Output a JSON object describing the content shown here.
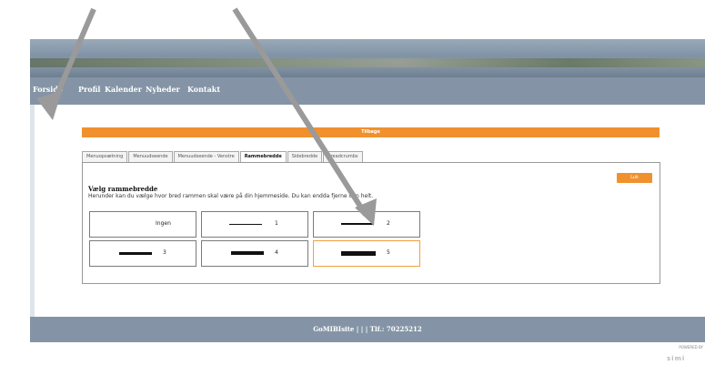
{
  "nav": {
    "items": [
      "Forside",
      "Profil",
      "Kalender",
      "Nyheder",
      "Kontakt"
    ]
  },
  "back_bar": {
    "label": "Tilbage"
  },
  "tabs": [
    "Menuopsætning",
    "Menuudseende",
    "Menuudseende - Venstre",
    "Rammebredde",
    "Sidebredde",
    "Breadcrumbs"
  ],
  "active_tab": "Rammebredde",
  "panel": {
    "title": "Vælg rammebredde",
    "description": "Herunder kan du vælge hvor bred rammen skal være på din hjemmeside. Du kan endda fjerne den helt.",
    "close_label": "Luk"
  },
  "options": [
    {
      "label": "Ingen",
      "thickness": 0,
      "selected": false
    },
    {
      "label": "1",
      "thickness": 1,
      "selected": false
    },
    {
      "label": "2",
      "thickness": 2,
      "selected": false
    },
    {
      "label": "3",
      "thickness": 3,
      "selected": false
    },
    {
      "label": "4",
      "thickness": 4,
      "selected": false
    },
    {
      "label": "5",
      "thickness": 5,
      "selected": true
    }
  ],
  "footer": {
    "text": "GoMIBIsite | | | Tlf.: 70225212"
  },
  "powered": {
    "line1": "POWERED BY",
    "logo": "simi"
  },
  "colors": {
    "accent": "#f0912e",
    "nav_bg": "#8494a6"
  }
}
